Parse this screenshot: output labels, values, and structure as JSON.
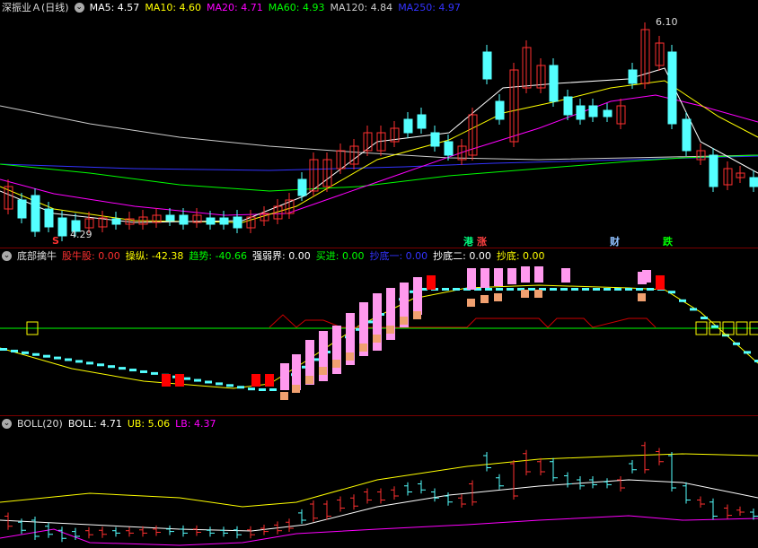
{
  "main": {
    "title": "深振业Ａ(日线)",
    "ma": [
      {
        "label": "MA5: 4.57",
        "color": "#ffffff"
      },
      {
        "label": "MA10: 4.60",
        "color": "#ffff00"
      },
      {
        "label": "MA20: 4.71",
        "color": "#ff00ff"
      },
      {
        "label": "MA60: 4.93",
        "color": "#00ff00"
      },
      {
        "label": "MA120: 4.84",
        "color": "#cccccc"
      },
      {
        "label": "MA250: 4.97",
        "color": "#3333ff"
      }
    ],
    "high_label": "6.10",
    "low_label": "4.29",
    "markers": [
      {
        "text": "S",
        "color": "#ff3030"
      },
      {
        "text": "港",
        "color": "#00ff80"
      },
      {
        "text": "涨",
        "color": "#ff4040"
      },
      {
        "text": "财",
        "color": "#8fc0ff"
      },
      {
        "text": "跌",
        "color": "#00ff00"
      }
    ]
  },
  "indicator": {
    "name": "底部擒牛",
    "items": [
      {
        "label": "股牛股: 0.00",
        "color": "#ff3030"
      },
      {
        "label": "操纵: -42.38",
        "color": "#ffff00"
      },
      {
        "label": "趋势: -40.66",
        "color": "#00ff00"
      },
      {
        "label": "强弱界: 0.00",
        "color": "#ffffff"
      },
      {
        "label": "买进: 0.00",
        "color": "#00ff00"
      },
      {
        "label": "抄底一: 0.00",
        "color": "#3333ff"
      },
      {
        "label": "抄底二: 0.00",
        "color": "#ffffff"
      },
      {
        "label": "抄底: 0.00",
        "color": "#ffff00"
      }
    ]
  },
  "boll": {
    "name": "BOLL(20)",
    "items": [
      {
        "label": "BOLL: 4.71",
        "color": "#ffffff"
      },
      {
        "label": "UB: 5.06",
        "color": "#ffff00"
      },
      {
        "label": "LB: 4.37",
        "color": "#ff00ff"
      }
    ]
  },
  "colors": {
    "up": "#ff3030",
    "down": "#54ffff",
    "bg": "#000000"
  }
}
